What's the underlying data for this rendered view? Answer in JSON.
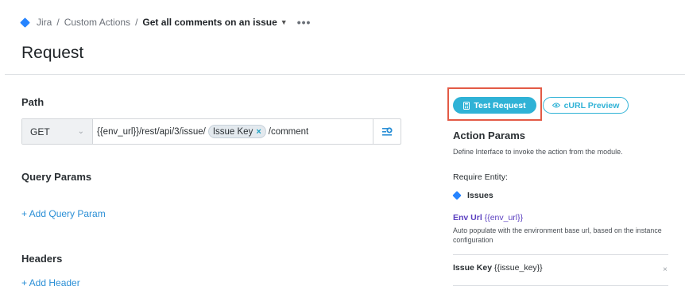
{
  "breadcrumb": {
    "items": [
      "Jira",
      "Custom Actions"
    ],
    "current": "Get all comments on an issue",
    "separator": "/",
    "more_icon": "more-horizontal-icon"
  },
  "page": {
    "title": "Request"
  },
  "path": {
    "label": "Path",
    "method": "GET",
    "url_prefix": "{{env_url}}/rest/api/3/issue/",
    "chip_label": "Issue Key",
    "chip_remove": "×",
    "url_suffix": "/comment",
    "insert_icon": "insert-variable-icon"
  },
  "query_params": {
    "label": "Query Params",
    "add_label": "+ Add Query Param"
  },
  "headers": {
    "label": "Headers",
    "add_label": "+ Add Header"
  },
  "actions": {
    "test_label": "Test Request",
    "curl_label": "cURL Preview"
  },
  "action_params": {
    "title": "Action Params",
    "description": "Define Interface to invoke the action from the module.",
    "require_entity_label": "Require Entity:",
    "entity": "Issues",
    "env_param_name": "Env Url",
    "env_param_var": "{{env_url}}",
    "env_param_desc": "Auto populate with the environment base url, based on the instance configuration",
    "issue_key_name": "Issue Key",
    "issue_key_var": "{{issue_key}}",
    "remove_icon": "×"
  },
  "colors": {
    "accent": "#2fb2d6",
    "highlight": "#e35a45",
    "link": "#2b8fd6",
    "param": "#5a3fc0",
    "jira": "#2684ff"
  }
}
